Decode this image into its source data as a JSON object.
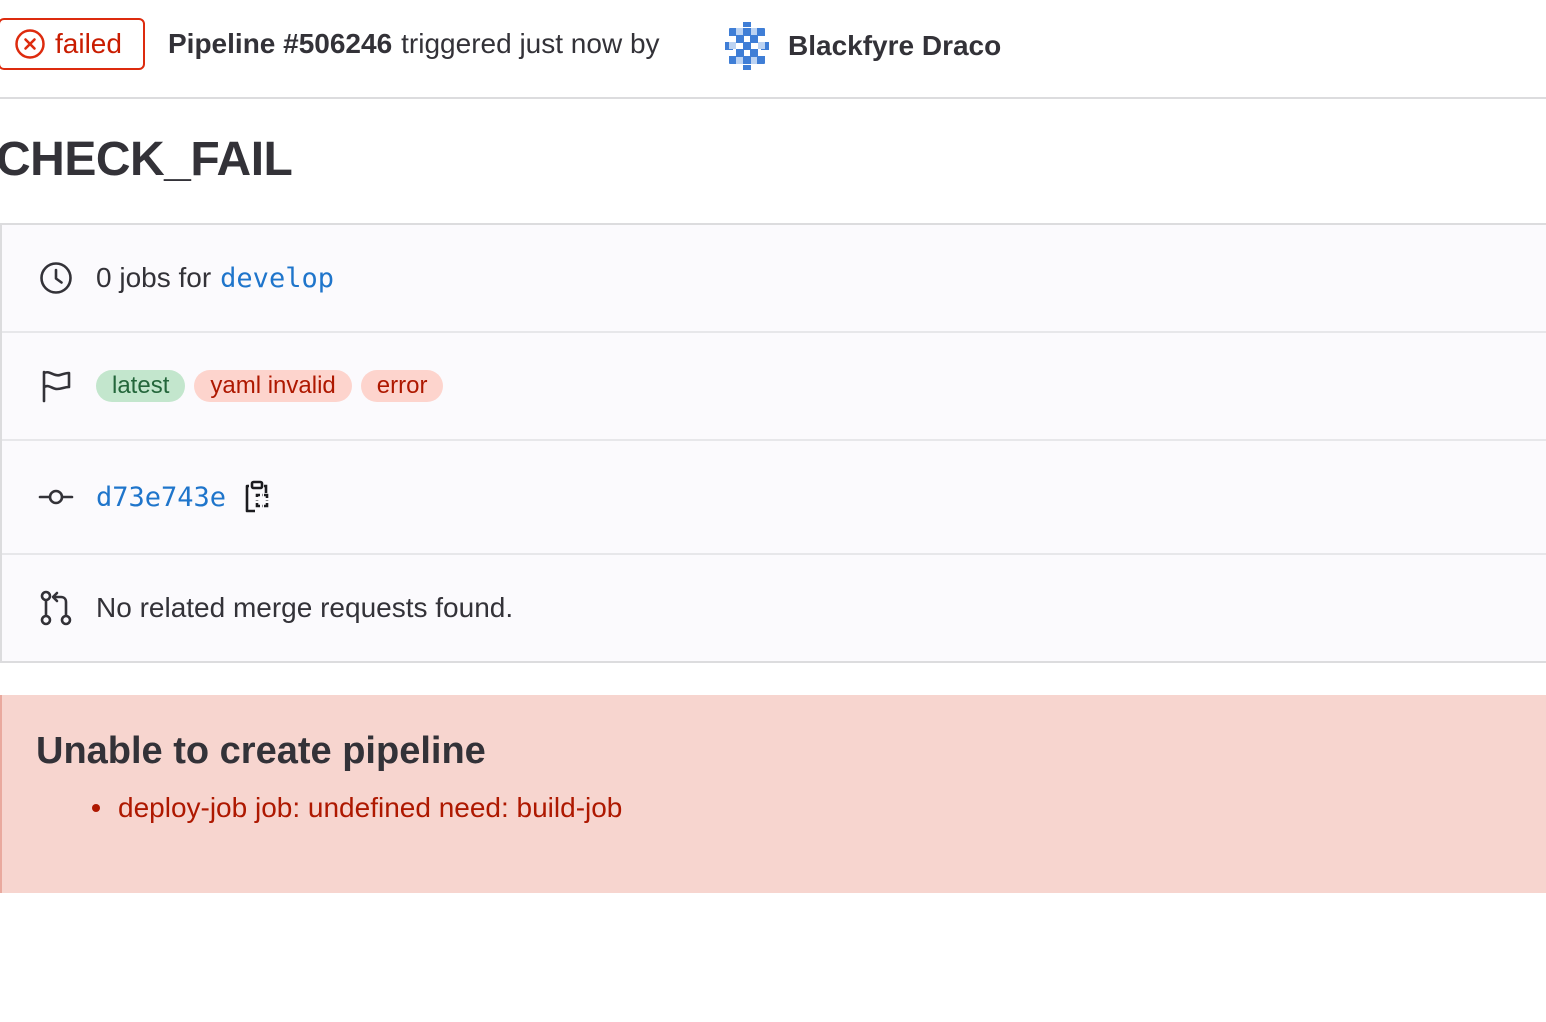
{
  "header": {
    "status_label": "failed",
    "pipeline_id": "Pipeline #506246",
    "trigger_text": "triggered just now by",
    "author_name": "Blackfyre Draco",
    "status_color": "#dd2b0e"
  },
  "title": "CHECK_FAIL",
  "info": {
    "jobs_prefix": "0 jobs for",
    "branch": "develop",
    "labels": [
      {
        "text": "latest",
        "variant": "success"
      },
      {
        "text": "yaml invalid",
        "variant": "danger"
      },
      {
        "text": "error",
        "variant": "danger"
      }
    ],
    "commit_sha": "d73e743e",
    "merge_requests_text": "No related merge requests found."
  },
  "icons": {
    "status": "circle-x-icon",
    "jobs": "clock-icon",
    "labels": "flag-icon",
    "commit": "commit-icon",
    "merge_request": "merge-request-icon",
    "copy": "clipboard-icon"
  },
  "error": {
    "title": "Unable to create pipeline",
    "items": [
      "deploy-job job: undefined need: build-job"
    ]
  },
  "colors": {
    "link": "#1f75cb",
    "danger_text": "#ae1800",
    "alert_bg": "#f7d5cf",
    "success_pill_bg": "#c3e6cd",
    "danger_pill_bg": "#fdd4cd"
  }
}
